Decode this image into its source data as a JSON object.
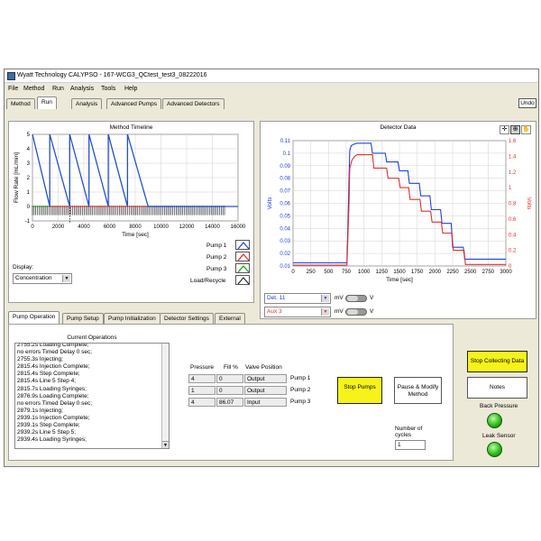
{
  "window": {
    "title": "Wyatt Technology CALYPSO - 167-WCG3_QCtest_test3_08222016"
  },
  "menu": [
    "File",
    "Method",
    "Run",
    "Analysis",
    "Tools",
    "Help"
  ],
  "tabs": [
    "Method",
    "Run",
    "Analysis",
    "Advanced Pumps",
    "Advanced Detectors"
  ],
  "undo_label": "Undo",
  "method_timeline": {
    "title": "Method Timeline",
    "display_label": "Display:",
    "display_value": "Concentration",
    "legend": [
      "Pump 1",
      "Pump 2",
      "Pump 3",
      "Load/Recycle"
    ]
  },
  "detector": {
    "title": "Detector Data",
    "det_select": "Det. 11",
    "aux_select": "Aux 3",
    "unit_mv": "mV",
    "unit_v": "V"
  },
  "chart_data": [
    {
      "type": "line",
      "title": "Method Timeline",
      "xlabel": "Time [sec]",
      "ylabel": "Flow Rate [mL/min]",
      "xlim": [
        0,
        16000
      ],
      "ylim": [
        -1,
        5
      ],
      "xticks": [
        0,
        2000,
        4000,
        6000,
        8000,
        10000,
        12000,
        14000,
        16000
      ],
      "yticks": [
        -1,
        0,
        1,
        2,
        3,
        4,
        5
      ],
      "grid": true,
      "series": [
        {
          "name": "Pump 1",
          "color": "#2050d0",
          "x": [
            0,
            1350,
            1350,
            2900,
            2900,
            4400,
            4400,
            5900,
            5900,
            7400,
            7400,
            9000,
            9000,
            16000
          ],
          "y": [
            5,
            0,
            5,
            0,
            5,
            0,
            5,
            0,
            5,
            0,
            5,
            0,
            0,
            0
          ]
        },
        {
          "name": "Pump 2",
          "color": "#e03030",
          "x": [
            1300,
            9000
          ],
          "y": [
            0,
            0
          ]
        },
        {
          "name": "Pump 3",
          "color": "#20a020",
          "x": [
            0,
            16000
          ],
          "y": [
            0,
            0
          ]
        }
      ]
    },
    {
      "type": "line",
      "title": "Detector Data",
      "xlabel": "Time [sec]",
      "ylabel": "Volts",
      "y2label": "Volts",
      "xlim": [
        0,
        3000
      ],
      "ylim": [
        0.01,
        0.11
      ],
      "y2lim": [
        0,
        1.6
      ],
      "xticks": [
        0,
        250,
        500,
        750,
        1000,
        1250,
        1500,
        1750,
        2000,
        2250,
        2500,
        2750,
        3000
      ],
      "yticks": [
        0.01,
        0.02,
        0.03,
        0.04,
        0.05,
        0.06,
        0.07,
        0.08,
        0.09,
        0.1,
        0.11
      ],
      "y2ticks": [
        0,
        0.2,
        0.4,
        0.6,
        0.8,
        1,
        1.2,
        1.4,
        1.6
      ],
      "grid": true,
      "series": [
        {
          "name": "Det. 11",
          "color": "#2040e0",
          "axis": "left",
          "x": [
            0,
            760,
            790,
            800,
            820,
            850,
            900,
            1100,
            1120,
            1300,
            1320,
            1480,
            1500,
            1620,
            1640,
            1780,
            1800,
            1930,
            1950,
            2080,
            2100,
            2230,
            2250,
            2400,
            2420,
            3000
          ],
          "y": [
            0.0125,
            0.0125,
            0.08,
            0.102,
            0.106,
            0.107,
            0.108,
            0.108,
            0.1,
            0.1,
            0.093,
            0.093,
            0.086,
            0.086,
            0.076,
            0.076,
            0.066,
            0.066,
            0.055,
            0.055,
            0.044,
            0.044,
            0.025,
            0.025,
            0.0155,
            0.0155
          ]
        },
        {
          "name": "Aux 3",
          "color": "#e03030",
          "axis": "right",
          "x": [
            0,
            760,
            790,
            800,
            830,
            870,
            900,
            1120,
            1140,
            1320,
            1340,
            1490,
            1510,
            1630,
            1650,
            1790,
            1810,
            1940,
            1960,
            2090,
            2110,
            2240,
            2260,
            2410,
            2430,
            3000
          ],
          "y": [
            0.01,
            0.01,
            0.8,
            1.25,
            1.35,
            1.4,
            1.42,
            1.42,
            1.25,
            1.25,
            1.12,
            1.12,
            1.0,
            1.0,
            0.85,
            0.85,
            0.7,
            0.7,
            0.56,
            0.56,
            0.42,
            0.42,
            0.2,
            0.2,
            0.02,
            0.02
          ]
        }
      ]
    }
  ],
  "bottom_tabs": [
    "Pump Operation",
    "Pump Setup",
    "Pump Initialization",
    "Detector Settings",
    "External"
  ],
  "ops": {
    "header": "Current Operations",
    "lines": [
      "2755.2s Loading Complete;",
      "no errors Timed Delay 0 sec;",
      "2755.3s Injecting;",
      "2815.4s Injection Complete;",
      "2815.4s Step Complete;",
      "2815.4s Line 5 Step 4;",
      "2815.7s Loading Syringes;",
      "2876.9s Loading Complete;",
      "no errors Timed Delay 0 sec;",
      "2879.1s Injecting;",
      "2939.1s Injection Complete;",
      "2939.1s Step Complete;",
      "2939.2s Line 5 Step 5;",
      "2939.4s Loading Syringes;"
    ]
  },
  "pump_table": {
    "headers": [
      "Pressure",
      "Fill %",
      "Valve Position"
    ],
    "rows": [
      {
        "pressure": "4",
        "fill": "0",
        "valve": "Output",
        "label": "Pump 1"
      },
      {
        "pressure": "1",
        "fill": "0",
        "valve": "Output",
        "label": "Pump 2"
      },
      {
        "pressure": "4",
        "fill": "86.07",
        "valve": "Input",
        "label": "Pump 3"
      }
    ]
  },
  "buttons": {
    "stop_pumps": "Stop Pumps",
    "pause": "Pause & Modify Method",
    "stop_collecting": "Stop Collecting Data",
    "notes": "Notes"
  },
  "cycles": {
    "label": "Number of cycles",
    "value": "1"
  },
  "status": {
    "back_pressure": "Back Pressure",
    "leak_sensor": "Leak Sensor"
  }
}
